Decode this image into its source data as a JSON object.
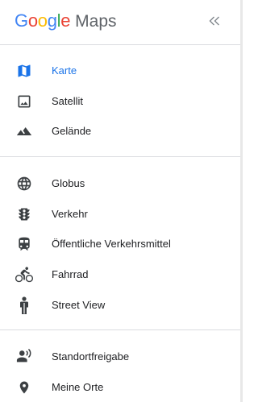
{
  "header": {
    "logo_letters": [
      {
        "ch": "G",
        "color": "#4285F4"
      },
      {
        "ch": "o",
        "color": "#EA4335"
      },
      {
        "ch": "o",
        "color": "#FBBC05"
      },
      {
        "ch": "g",
        "color": "#4285F4"
      },
      {
        "ch": "l",
        "color": "#34A853"
      },
      {
        "ch": "e",
        "color": "#EA4335"
      }
    ],
    "logo_suffix": "Maps",
    "collapse_glyph": "«"
  },
  "colors": {
    "accent": "#1a73e8",
    "icon": "#3c4043",
    "divider": "#dadce0"
  },
  "sections": {
    "map_types": [
      {
        "label": "Karte",
        "icon": "map-icon",
        "active": true
      },
      {
        "label": "Satellit",
        "icon": "satellite-image-icon",
        "active": false
      },
      {
        "label": "Gelände",
        "icon": "terrain-icon",
        "active": false
      }
    ],
    "layers": [
      {
        "label": "Globus",
        "icon": "globe-icon"
      },
      {
        "label": "Verkehr",
        "icon": "traffic-light-icon"
      },
      {
        "label": "Öffentliche Verkehrsmittel",
        "icon": "train-icon"
      },
      {
        "label": "Fahrrad",
        "icon": "bicycle-icon"
      },
      {
        "label": "Street View",
        "icon": "pegman-icon"
      }
    ],
    "personal": [
      {
        "label": "Standortfreigabe",
        "icon": "location-sharing-icon"
      },
      {
        "label": "Meine Orte",
        "icon": "place-pin-icon"
      }
    ]
  }
}
